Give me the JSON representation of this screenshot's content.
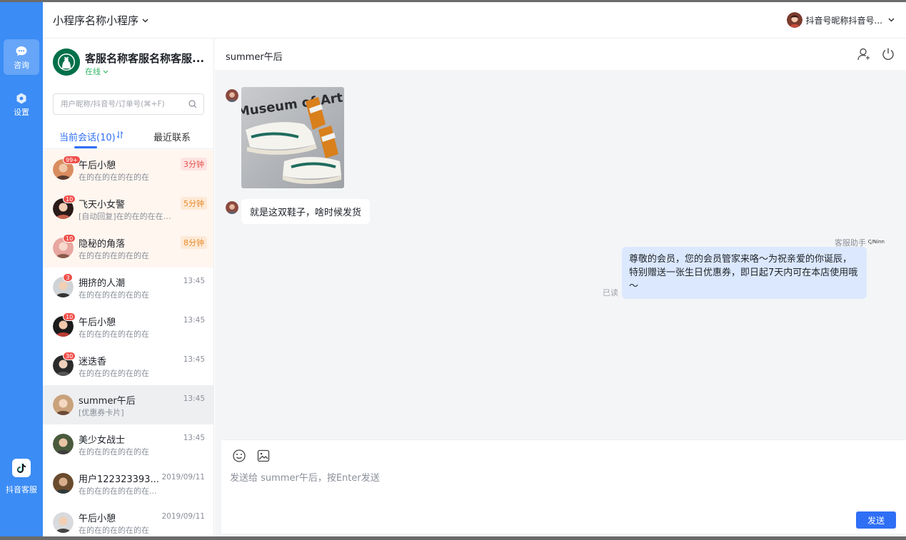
{
  "rail": {
    "items": [
      {
        "label": "咨询",
        "icon": "chat-bubble-icon",
        "active": true
      },
      {
        "label": "设置",
        "icon": "settings-hexagon-icon",
        "active": false
      }
    ],
    "bottom": {
      "label": "抖音客服",
      "icon": "douyin-logo-icon"
    }
  },
  "topbar": {
    "mini_program": "小程序名称小程序",
    "user": "抖音号昵称抖音号..."
  },
  "service": {
    "name": "客服名称客服名称客服...",
    "status": "在线"
  },
  "search": {
    "placeholder": "用户昵称/抖音号/订单号(⌘+F)"
  },
  "tabs": {
    "current": "当前会话(10)",
    "recent": "最近联系"
  },
  "conversations": [
    {
      "name": "午后小憩",
      "msg": "在的在的在的在的在",
      "time": "3分钟",
      "badge": "99+",
      "tag": "red"
    },
    {
      "name": "飞天小女警",
      "msg": "[自动回复]在的在的在在的...",
      "time": "5分钟",
      "badge": "10",
      "tag": "orange"
    },
    {
      "name": "隐秘的角落",
      "msg": "在的在的在的在的在",
      "time": "8分钟",
      "badge": "10",
      "tag": "orange"
    },
    {
      "name": "拥挤的人潮",
      "msg": "在的在的在的在的在",
      "time": "13:45",
      "badge": "3"
    },
    {
      "name": "午后小憩",
      "msg": "在的在的在的在的在",
      "time": "13:45",
      "badge": "10"
    },
    {
      "name": "迷迭香",
      "msg": "在的在的在的在的在",
      "time": "13:45",
      "badge": "30"
    },
    {
      "name": "summer午后",
      "msg": "[优惠券卡片]",
      "time": "13:45",
      "badge": "",
      "selected": true
    },
    {
      "name": "美少女战士",
      "msg": "在的在的在的在的在",
      "time": "13:45",
      "badge": ""
    },
    {
      "name": "用户122323393...",
      "msg": "在的在的在的在的在...",
      "time": "2019/09/11",
      "badge": ""
    },
    {
      "name": "午后小憩",
      "msg": "在的在的在的在的在",
      "time": "2019/09/11",
      "badge": ""
    }
  ],
  "chat": {
    "title": "summer午后",
    "image_text": "Museum of Art",
    "user_message": "就是这双鞋子，啥时候发货",
    "agent_label": "客服助手",
    "agent_logo": "Ҁ/Ninn",
    "agent_message": "尊敬的会员，您的会员管家来咯～为祝亲爱的你诞辰，特别赠送一张生日优惠券，即日起7天内可在本店使用哦～",
    "read": "已读"
  },
  "composer": {
    "placeholder": "发送给 summer午后，按Enter发送",
    "send": "发送"
  },
  "colors": {
    "accent": "#2f6ff5",
    "rail": "#3b8cf5",
    "online": "#2fb765"
  }
}
